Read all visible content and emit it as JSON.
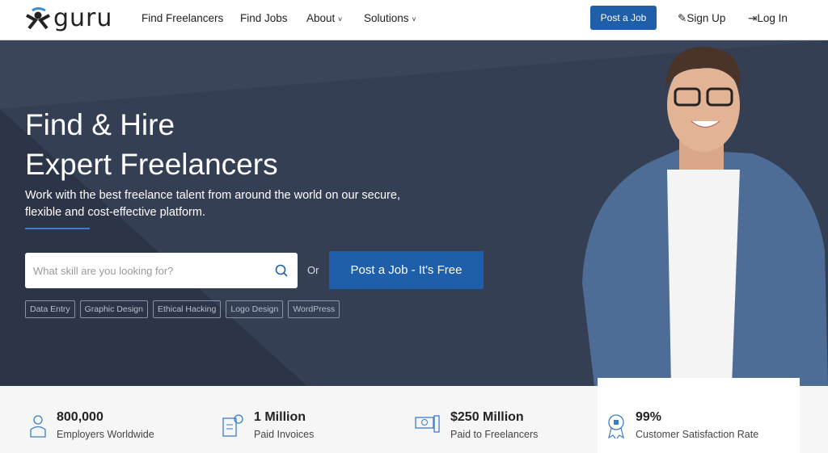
{
  "nav": {
    "logo": "guru",
    "links": [
      "Find Freelancers",
      "Find Jobs",
      "About",
      "Solutions"
    ],
    "post_job": "Post a Job",
    "sign_up": "Sign Up",
    "log_in": "Log In"
  },
  "hero": {
    "title_line1": "Find & Hire",
    "title_line2": "Expert Freelancers",
    "subtitle_line1": "Work with the best freelance talent from around the world on our secure,",
    "subtitle_line2": "flexible and cost-effective platform.",
    "search_placeholder": "What skill are you looking for?",
    "or": "Or",
    "cta": "Post a Job - It's Free",
    "tags": [
      "Data Entry",
      "Graphic Design",
      "Ethical Hacking",
      "Logo Design",
      "WordPress"
    ]
  },
  "stats": [
    {
      "value": "800,000",
      "label": "Employers Worldwide",
      "icon": "employer-icon"
    },
    {
      "value": "1 Million",
      "label": "Paid Invoices",
      "icon": "invoice-icon"
    },
    {
      "value": "$250 Million",
      "label": "Paid to Freelancers",
      "icon": "money-icon"
    },
    {
      "value": "99%",
      "label": "Customer Satisfaction Rate",
      "icon": "award-icon"
    }
  ],
  "colors": {
    "accent": "#1f5ea8",
    "hero_bg": "#2c3547"
  }
}
